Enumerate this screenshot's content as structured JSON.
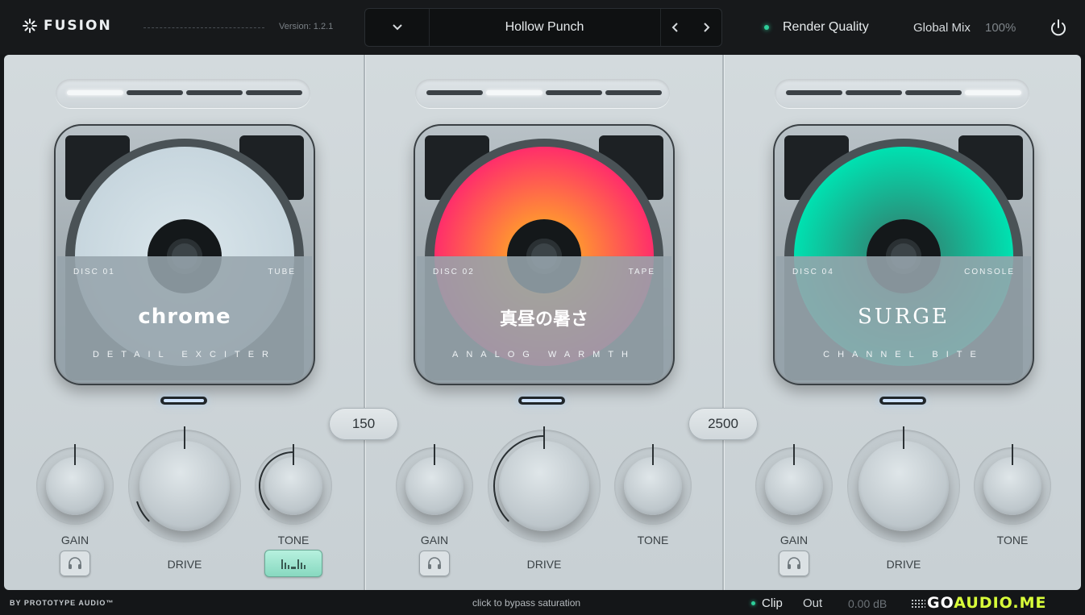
{
  "header": {
    "logo": "FUSION",
    "version": "Version: 1.2.1",
    "preset_name": "Hollow Punch",
    "render_quality": "Render Quality",
    "global_mix_label": "Global Mix",
    "global_mix_value": "100%",
    "icons": [
      "fusion-logo-icon",
      "chevron-down-icon",
      "chevron-left-icon",
      "chevron-right-icon",
      "power-icon"
    ]
  },
  "slots": [
    {
      "disc_no": "DISC 01",
      "disc_type": "TUBE",
      "title": "chrome",
      "subtitle": "DETAIL EXCITER",
      "disc_colors": [
        "#c7d6de",
        "#d5e2e8"
      ],
      "active_segment": 1,
      "gain_label": "GAIN",
      "drive_label": "DRIVE",
      "tone_label": "TONE",
      "drive_level": 0.1,
      "tone_level": 0.5,
      "tone_active": true
    },
    {
      "disc_no": "DISC 02",
      "disc_type": "TAPE",
      "title": "真昼の暑さ",
      "subtitle": "ANALOG WARMTH",
      "disc_colors": [
        "#ff2f6a",
        "#ff9a2e"
      ],
      "active_segment": 2,
      "gain_label": "GAIN",
      "drive_label": "DRIVE",
      "tone_label": "TONE",
      "drive_level": 0.5,
      "tone_level": 0,
      "tone_active": false
    },
    {
      "disc_no": "DISC 04",
      "disc_type": "CONSOLE",
      "title": "SURGE",
      "subtitle": "CHANNEL BITE",
      "disc_colors": [
        "#00e0b0",
        "#2a8f7a"
      ],
      "active_segment": 4,
      "gain_label": "GAIN",
      "drive_label": "DRIVE",
      "tone_label": "TONE",
      "drive_level": 0,
      "tone_level": 0,
      "tone_active": false
    }
  ],
  "crossovers": [
    "150",
    "2500"
  ],
  "footer": {
    "brand": "BY PROTOTYPE AUDIO™",
    "hint": "click to bypass saturation",
    "clip": "Clip",
    "out_label": "Out",
    "out_value": "0.00 dB",
    "watermark_a": "GO",
    "watermark_b": "AUDIO.ME"
  },
  "colors": {
    "accent": "#2ecf9a",
    "panel": "#cfd6da",
    "topbar": "#17191b"
  }
}
